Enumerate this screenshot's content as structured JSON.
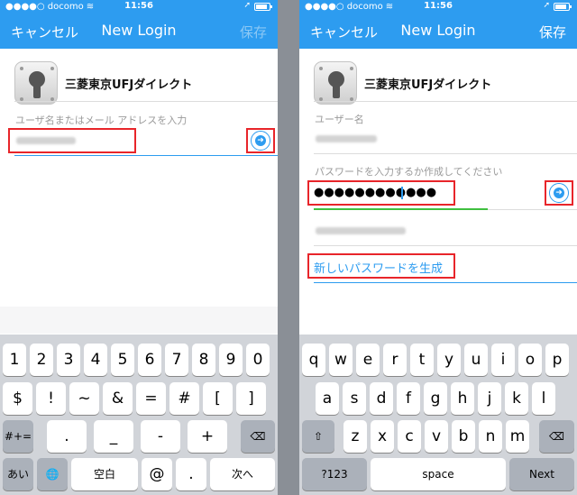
{
  "status": {
    "carrier": "●●●●○ docomo",
    "time": "11:56"
  },
  "left": {
    "nav": {
      "cancel": "キャンセル",
      "title": "New Login",
      "save": "保存"
    },
    "app_name": "三菱東京UFJダイレクト",
    "username_label": "ユーザ名またはメール アドレスを入力",
    "keyboard": {
      "row1": [
        "1",
        "2",
        "3",
        "4",
        "5",
        "6",
        "7",
        "8",
        "9",
        "0"
      ],
      "row2": [
        "$",
        "!",
        "~",
        "&",
        "=",
        "#",
        "[",
        "]"
      ],
      "row3_left": "#+=",
      "row3": [
        ".",
        "_",
        "-",
        "+"
      ],
      "row4": {
        "kana": "あいう",
        "space": "空白",
        "at": "@",
        "dot": ".",
        "next": "次へ"
      }
    }
  },
  "right": {
    "nav": {
      "cancel": "キャンセル",
      "title": "New Login",
      "save": "保存"
    },
    "app_name": "三菱東京UFJダイレクト",
    "username_label": "ユーザー名",
    "password_label": "パスワードを入力するか作成してください",
    "password_value": "●●●●●●●●●●●●",
    "generate_link": "新しいパスワードを生成",
    "keyboard": {
      "row1": [
        "q",
        "w",
        "e",
        "r",
        "t",
        "y",
        "u",
        "i",
        "o",
        "p"
      ],
      "row2": [
        "a",
        "s",
        "d",
        "f",
        "g",
        "h",
        "j",
        "k",
        "l"
      ],
      "row3": [
        "z",
        "x",
        "c",
        "v",
        "b",
        "n",
        "m"
      ],
      "row4": {
        "numbers": "?123",
        "space": "space",
        "next": "Next"
      }
    }
  }
}
